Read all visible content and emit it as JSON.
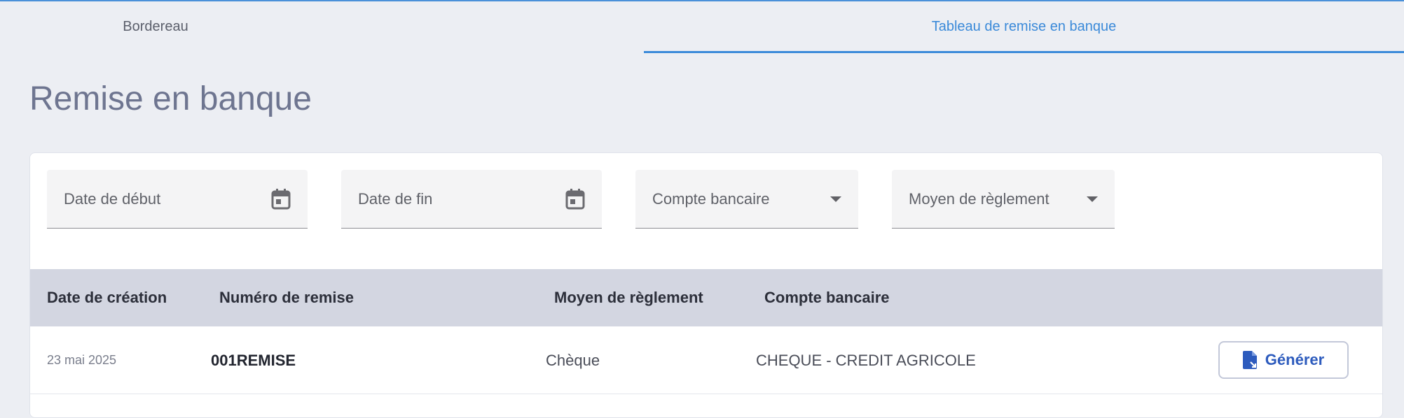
{
  "tabs": [
    {
      "label": "Bordereau",
      "active": false
    },
    {
      "label": "Tableau de remise en banque",
      "active": true
    }
  ],
  "page": {
    "title": "Remise en banque"
  },
  "filters": {
    "start_date": {
      "label": "Date de début",
      "icon": "calendar-icon"
    },
    "end_date": {
      "label": "Date de fin",
      "icon": "calendar-icon"
    },
    "bank_account": {
      "label": "Compte bancaire",
      "icon": "chevron-down-icon"
    },
    "payment_method": {
      "label": "Moyen de règlement",
      "icon": "chevron-down-icon"
    }
  },
  "table": {
    "columns": [
      "Date de création",
      "Numéro de remise",
      "Moyen de règlement",
      "Compte bancaire"
    ],
    "rows": [
      {
        "date": "23 mai 2025",
        "number": "001REMISE",
        "method": "Chèque",
        "account": "CHEQUE - CREDIT AGRICOLE",
        "action_label": "Générer"
      }
    ]
  },
  "colors": {
    "accent": "#3b8ad9",
    "button_text": "#2d5bbd",
    "header_bg": "#d3d6e1"
  }
}
